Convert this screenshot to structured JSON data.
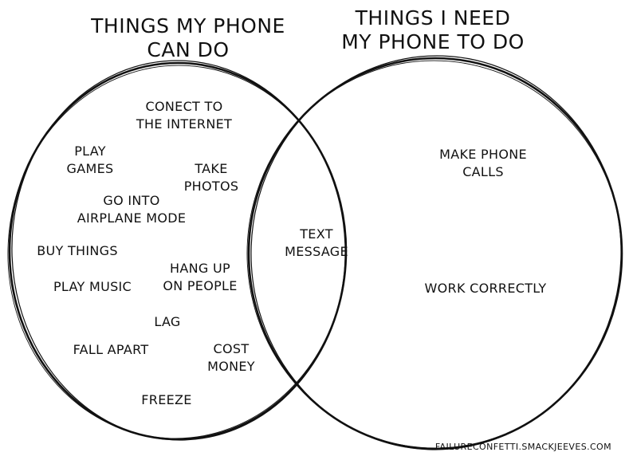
{
  "titles": {
    "left": "THINGS MY PHONE\nCAN DO",
    "right": "THINGS I NEED\nMY PHONE TO DO"
  },
  "left_only": [
    "CONECT TO\nTHE INTERNET",
    "PLAY\nGAMES",
    "TAKE\nPHOTOS",
    "GO INTO\nAIRPLANE MODE",
    "BUY THINGS",
    "HANG UP\nON PEOPLE",
    "PLAY MUSIC",
    "LAG",
    "FALL APART",
    "COST\nMONEY",
    "FREEZE"
  ],
  "intersection": [
    "TEXT\nMESSAGE"
  ],
  "right_only": [
    "MAKE PHONE\nCALLS",
    "WORK CORRECTLY"
  ],
  "credit": "FAILURECONFETTI.SMACKJEEVES.COM",
  "colors": {
    "ink": "#111111",
    "paper": "#ffffff"
  }
}
